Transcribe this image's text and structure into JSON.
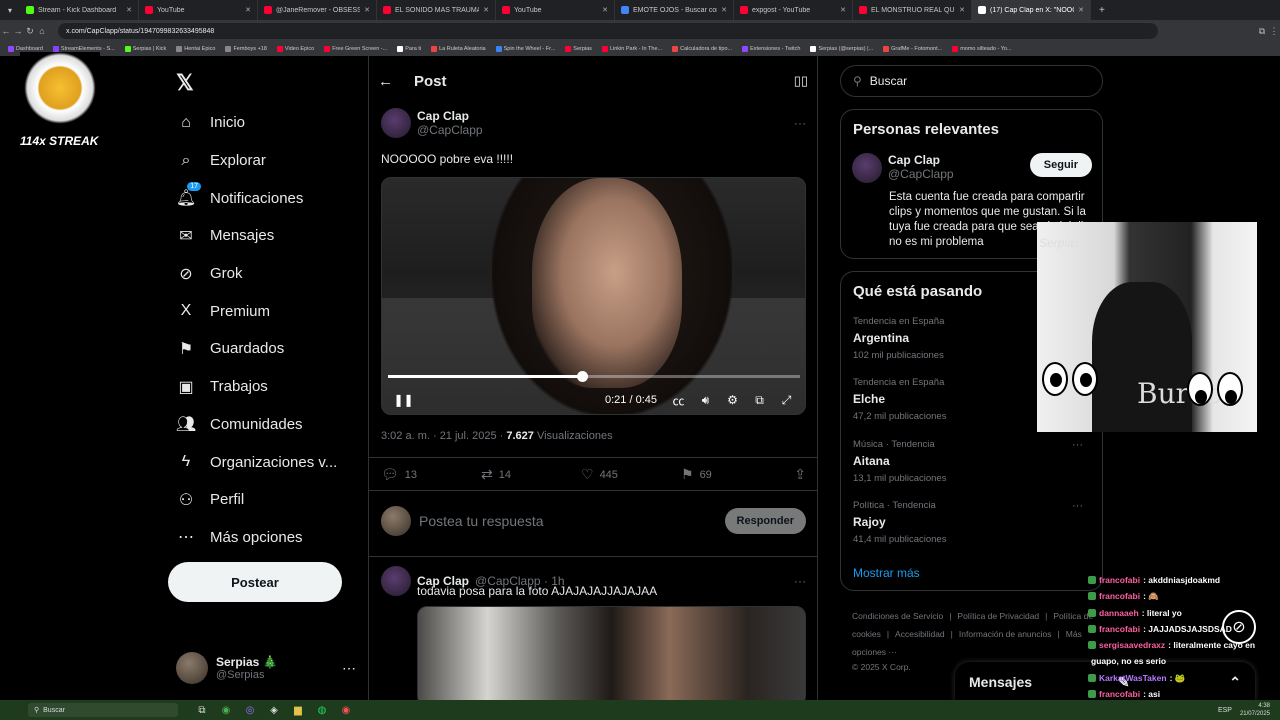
{
  "browser": {
    "tabs": [
      {
        "label": "Stream - Kick Dashboard",
        "color": "#53fc18"
      },
      {
        "label": "YouTube",
        "color": "#ff0033"
      },
      {
        "label": "@JaneRemover - OBSESSED PO",
        "color": "#ff0033"
      },
      {
        "label": "EL SONIDO MÁS TRAUMATIZA",
        "color": "#ff0033"
      },
      {
        "label": "YouTube",
        "color": "#ff0033"
      },
      {
        "label": "EMOTE OJOS - Buscar con Goo",
        "color": "#4285f4"
      },
      {
        "label": "expgost - YouTube",
        "color": "#ff0033"
      },
      {
        "label": "EL MONSTRUO REAL QUE INSP",
        "color": "#ff0033"
      },
      {
        "label": "(17) Cap Clap en X: \"NOOO",
        "color": "#ffffff"
      }
    ],
    "url": "x.com/CapClapp/status/1947099832633495848",
    "bookmarks": [
      {
        "label": "Dashboard",
        "color": "#9146ff"
      },
      {
        "label": "StreamElements - S...",
        "color": "#8a3ffc"
      },
      {
        "label": "Serpias | Kick",
        "color": "#53fc18"
      },
      {
        "label": "Hentai Epico",
        "color": "#888888"
      },
      {
        "label": "Femboys +18",
        "color": "#888888"
      },
      {
        "label": "Video Epico",
        "color": "#ff0033"
      },
      {
        "label": "Free Green Screen -...",
        "color": "#ff0033"
      },
      {
        "label": "Para ti",
        "color": "#ffffff"
      },
      {
        "label": "La Ruleta Aleatoria",
        "color": "#e44"
      },
      {
        "label": "Spin the Wheel - Fr...",
        "color": "#3b82f6"
      },
      {
        "label": "Serpias",
        "color": "#ff0033"
      },
      {
        "label": "Linkin Park - In The...",
        "color": "#ff0033"
      },
      {
        "label": "Calculadora de tipo...",
        "color": "#e44"
      },
      {
        "label": "Extensiones - Twitch",
        "color": "#9146ff"
      },
      {
        "label": "Serpias (@serpias) |...",
        "color": "#ffffff"
      },
      {
        "label": "GrafMe - Fotomont...",
        "color": "#e44"
      },
      {
        "label": "momo silteado - Yo...",
        "color": "#ff0033"
      }
    ]
  },
  "streak": {
    "label": "114x STREAK"
  },
  "sidebar": {
    "items": [
      {
        "label": "Inicio",
        "icon": "⌂"
      },
      {
        "label": "Explorar",
        "icon": "⌕"
      },
      {
        "label": "Notificaciones",
        "icon": "🔔︎",
        "badge": "17"
      },
      {
        "label": "Mensajes",
        "icon": "✉"
      },
      {
        "label": "Grok",
        "icon": "⊘"
      },
      {
        "label": "Premium",
        "icon": "X"
      },
      {
        "label": "Guardados",
        "icon": "⚑"
      },
      {
        "label": "Trabajos",
        "icon": "▣"
      },
      {
        "label": "Comunidades",
        "icon": "👥︎"
      },
      {
        "label": "Organizaciones v...",
        "icon": "ϟ"
      },
      {
        "label": "Perfil",
        "icon": "⚇"
      },
      {
        "label": "Más opciones",
        "icon": "⋯"
      }
    ],
    "post_button": "Postear",
    "profile": {
      "name": "Serpias 🎄",
      "handle": "@Serpias"
    }
  },
  "post": {
    "header": "Post",
    "author_name": "Cap Clap",
    "author_handle": "@CapClapp",
    "text": "NOOOOO pobre eva !!!!!",
    "video": {
      "time": "0:21 / 0:45",
      "progress": 0.47
    },
    "meta_time": "3:02 a. m. · 21 jul. 2025 · ",
    "views": "7.627",
    "views_label": " Visualizaciones",
    "actions": {
      "replies": "13",
      "reposts": "14",
      "likes": "445",
      "bookmarks": "69"
    },
    "reply_placeholder": "Postea tu respuesta",
    "reply_button": "Responder"
  },
  "reply": {
    "author_name": "Cap Clap",
    "author_handle": "@CapClapp · 1h",
    "text": "todavia posa para la foto  AJAJAJAJJAJAJAA"
  },
  "search": {
    "placeholder": "Buscar"
  },
  "relevant": {
    "title": "Personas relevantes",
    "name": "Cap Clap",
    "handle": "@CapClapp",
    "follow": "Seguir",
    "bio": "Esta cuenta fue creada para compartir clips y momentos que me gustan. Si la tuya fue creada para que seas imbécil, no es mi problema"
  },
  "trending": {
    "title": "Qué está pasando",
    "items": [
      {
        "category": "Tendencia en España",
        "title": "Argentina",
        "count": "102 mil publicaciones"
      },
      {
        "category": "Tendencia en España",
        "title": "Elche",
        "count": "47,2 mil publicaciones"
      },
      {
        "category": "Música · Tendencia",
        "title": "Aitana",
        "count": "13,1 mil publicaciones"
      },
      {
        "category": "Política · Tendencia",
        "title": "Rajoy",
        "count": "41,4 mil publicaciones"
      }
    ],
    "show_more": "Mostrar más"
  },
  "footer": {
    "links": [
      "Condiciones de Servicio",
      "|",
      "Política de Privacidad",
      "|",
      "Política de cookies",
      "|",
      "Accesibilidad",
      "|",
      "Información de anuncios",
      "|",
      "Más opciones ···"
    ],
    "copyright": "© 2025 X Corp."
  },
  "messages": {
    "title": "Mensajes"
  },
  "webcam": {
    "watermark": "Serpias",
    "shirt_text": "Burac"
  },
  "chat": [
    {
      "user": "francofabi",
      "color": "#ff5fa2",
      "message": ": akddniasjdoakmd"
    },
    {
      "user": "francofabi",
      "color": "#ff5fa2",
      "message": ": 🙈"
    },
    {
      "user": "dannaaeh",
      "color": "#ff5fa2",
      "message": ": literal yo"
    },
    {
      "user": "francofabi",
      "color": "#ff5fa2",
      "message": ": JAJJADSJAJSDSAD"
    },
    {
      "user": "sergisaavedraxz",
      "color": "#ff5fa2",
      "message": ": literalmente cayó en"
    },
    {
      "user": "",
      "color": "#ffffff",
      "message": "guapo, no es serio"
    },
    {
      "user": "KarkatWasTaken",
      "color": "#b27cff",
      "message": ": 🐸"
    },
    {
      "user": "francofabi",
      "color": "#ff5fa2",
      "message": ": asi"
    },
    {
      "user": "francofabi",
      "color": "#ff5fa2",
      "message": ": 🐸"
    }
  ],
  "taskbar": {
    "search": "Buscar",
    "lang": "ESP",
    "time": "4:38",
    "date": "21/07/2025"
  }
}
